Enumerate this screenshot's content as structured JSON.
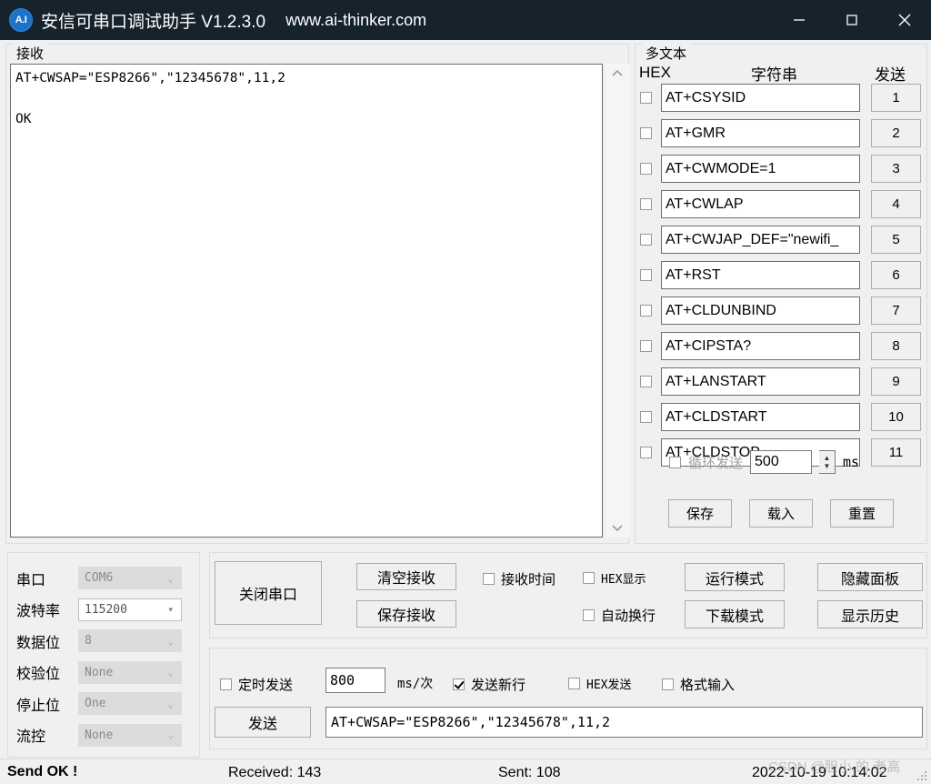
{
  "window": {
    "title": "安信可串口调试助手 V1.2.3.0",
    "url": "www.ai-thinker.com",
    "icon_label": "A.I",
    "minimize_icon": "minimize-icon",
    "maximize_icon": "maximize-icon",
    "close_icon": "close-icon"
  },
  "receive": {
    "group_label": "接收",
    "content": "AT+CWSAP=\"ESP8266\",\"12345678\",11,2\n\nOK",
    "scroll_up_icon": "chevron-up-icon",
    "scroll_down_icon": "chevron-down-icon"
  },
  "multitext": {
    "group_label": "多文本",
    "header_hex": "HEX",
    "header_string": "字符串",
    "header_send": "发送",
    "rows": [
      {
        "hex": false,
        "command": "AT+CSYSID",
        "send_label": "1"
      },
      {
        "hex": false,
        "command": "AT+GMR",
        "send_label": "2"
      },
      {
        "hex": false,
        "command": "AT+CWMODE=1",
        "send_label": "3"
      },
      {
        "hex": false,
        "command": "AT+CWLAP",
        "send_label": "4"
      },
      {
        "hex": false,
        "command": "AT+CWJAP_DEF=\"newifi_",
        "send_label": "5"
      },
      {
        "hex": false,
        "command": "AT+RST",
        "send_label": "6"
      },
      {
        "hex": false,
        "command": "AT+CLDUNBIND",
        "send_label": "7"
      },
      {
        "hex": false,
        "command": "AT+CIPSTA?",
        "send_label": "8"
      },
      {
        "hex": false,
        "command": "AT+LANSTART",
        "send_label": "9"
      },
      {
        "hex": false,
        "command": "AT+CLDSTART",
        "send_label": "10"
      },
      {
        "hex": false,
        "command": "AT+CLDSTOP",
        "send_label": "11"
      }
    ],
    "loop_send_label": "循环发送",
    "loop_send_checked": false,
    "loop_send_enabled": false,
    "loop_interval": "500",
    "loop_unit": "ms",
    "save_label": "保存",
    "load_label": "载入",
    "reset_label": "重置"
  },
  "serial_settings": {
    "rows": [
      {
        "label": "串口",
        "value": "COM6",
        "enabled": false
      },
      {
        "label": "波特率",
        "value": "115200",
        "enabled": true
      },
      {
        "label": "数据位",
        "value": "8",
        "enabled": false
      },
      {
        "label": "校验位",
        "value": "None",
        "enabled": false
      },
      {
        "label": "停止位",
        "value": "One",
        "enabled": false
      },
      {
        "label": "流控",
        "value": "None",
        "enabled": false
      }
    ],
    "chevron_icon": "chevron-down-icon"
  },
  "controls": {
    "close_serial_label": "关闭串口",
    "clear_receive_label": "清空接收",
    "save_receive_label": "保存接收",
    "receive_time_label": "接收时间",
    "receive_time_checked": false,
    "hex_show_label": "HEX显示",
    "hex_show_checked": false,
    "auto_wrap_label": "自动换行",
    "auto_wrap_checked": false,
    "run_mode_label": "运行模式",
    "download_mode_label": "下载模式",
    "hide_panel_label": "隐藏面板",
    "show_history_label": "显示历史"
  },
  "send_panel": {
    "timed_send_label": "定时发送",
    "timed_send_checked": false,
    "timed_interval": "800",
    "timed_unit": "ms/次",
    "send_newline_label": "发送新行",
    "send_newline_checked": true,
    "hex_send_label": "HEX发送",
    "hex_send_checked": false,
    "format_input_label": "格式输入",
    "format_input_checked": false,
    "send_button_label": "发送",
    "send_text": "AT+CWSAP=\"ESP8266\",\"12345678\",11,2"
  },
  "statusbar": {
    "status": "Send OK !",
    "received": "Received: 143",
    "sent": "Sent: 108",
    "timestamp": "2022-10-19 10:14:02",
    "watermark": "CSDN @胆小 的 老高"
  },
  "colors": {
    "titlebar": "#16222c",
    "accent": "#1d72c6",
    "panel": "#f0f0f0",
    "field": "#ffffff"
  }
}
